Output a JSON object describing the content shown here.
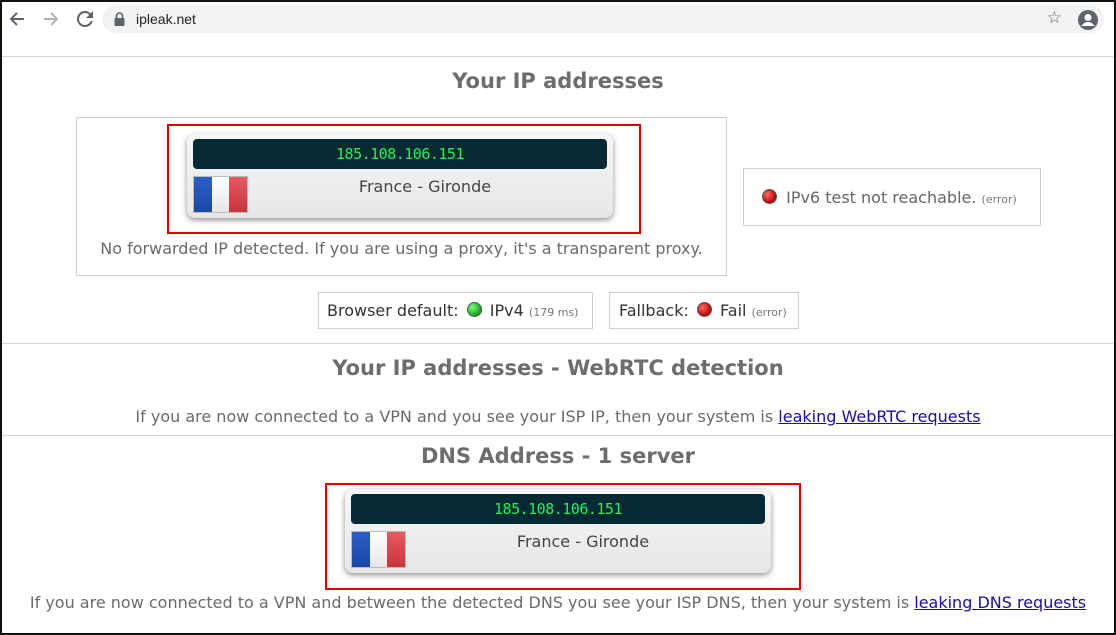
{
  "browser": {
    "url": "ipleak.net",
    "icons": [
      "back-arrow-icon",
      "forward-arrow-icon",
      "reload-icon",
      "lock-icon",
      "star-icon",
      "account-icon"
    ]
  },
  "ip_section": {
    "title": "Your IP addresses",
    "ip": "185.108.106.151",
    "location": "France - Gironde",
    "forwarded_note": "No forwarded IP detected. If you are using a proxy, it's a transparent proxy.",
    "ipv6_text": "IPv6 test not reachable.",
    "ipv6_status": "(error)",
    "browser_default_label": "Browser default:",
    "browser_default_value": "IPv4",
    "browser_default_time": "(179 ms)",
    "fallback_label": "Fallback:",
    "fallback_value": "Fail",
    "fallback_status": "(error)"
  },
  "webrtc_section": {
    "title": "Your IP addresses - WebRTC detection",
    "note_text": "If you are now connected to a VPN and you see your ISP IP, then your system is ",
    "note_link": "leaking WebRTC requests"
  },
  "dns_section": {
    "title": "DNS Address - 1 server",
    "ip": "185.108.106.151",
    "location": "France - Gironde",
    "note_text": "If you are now connected to a VPN and between the detected DNS you see your ISP DNS, then your system is ",
    "note_link": "leaking DNS requests"
  },
  "colors": {
    "flag_blue": "#2b5fc9",
    "flag_white": "#f4f4f4",
    "flag_red": "#e0464b",
    "ip_bar_bg": "#062a33",
    "ip_text": "#1df25a",
    "highlight": "#e00000"
  }
}
